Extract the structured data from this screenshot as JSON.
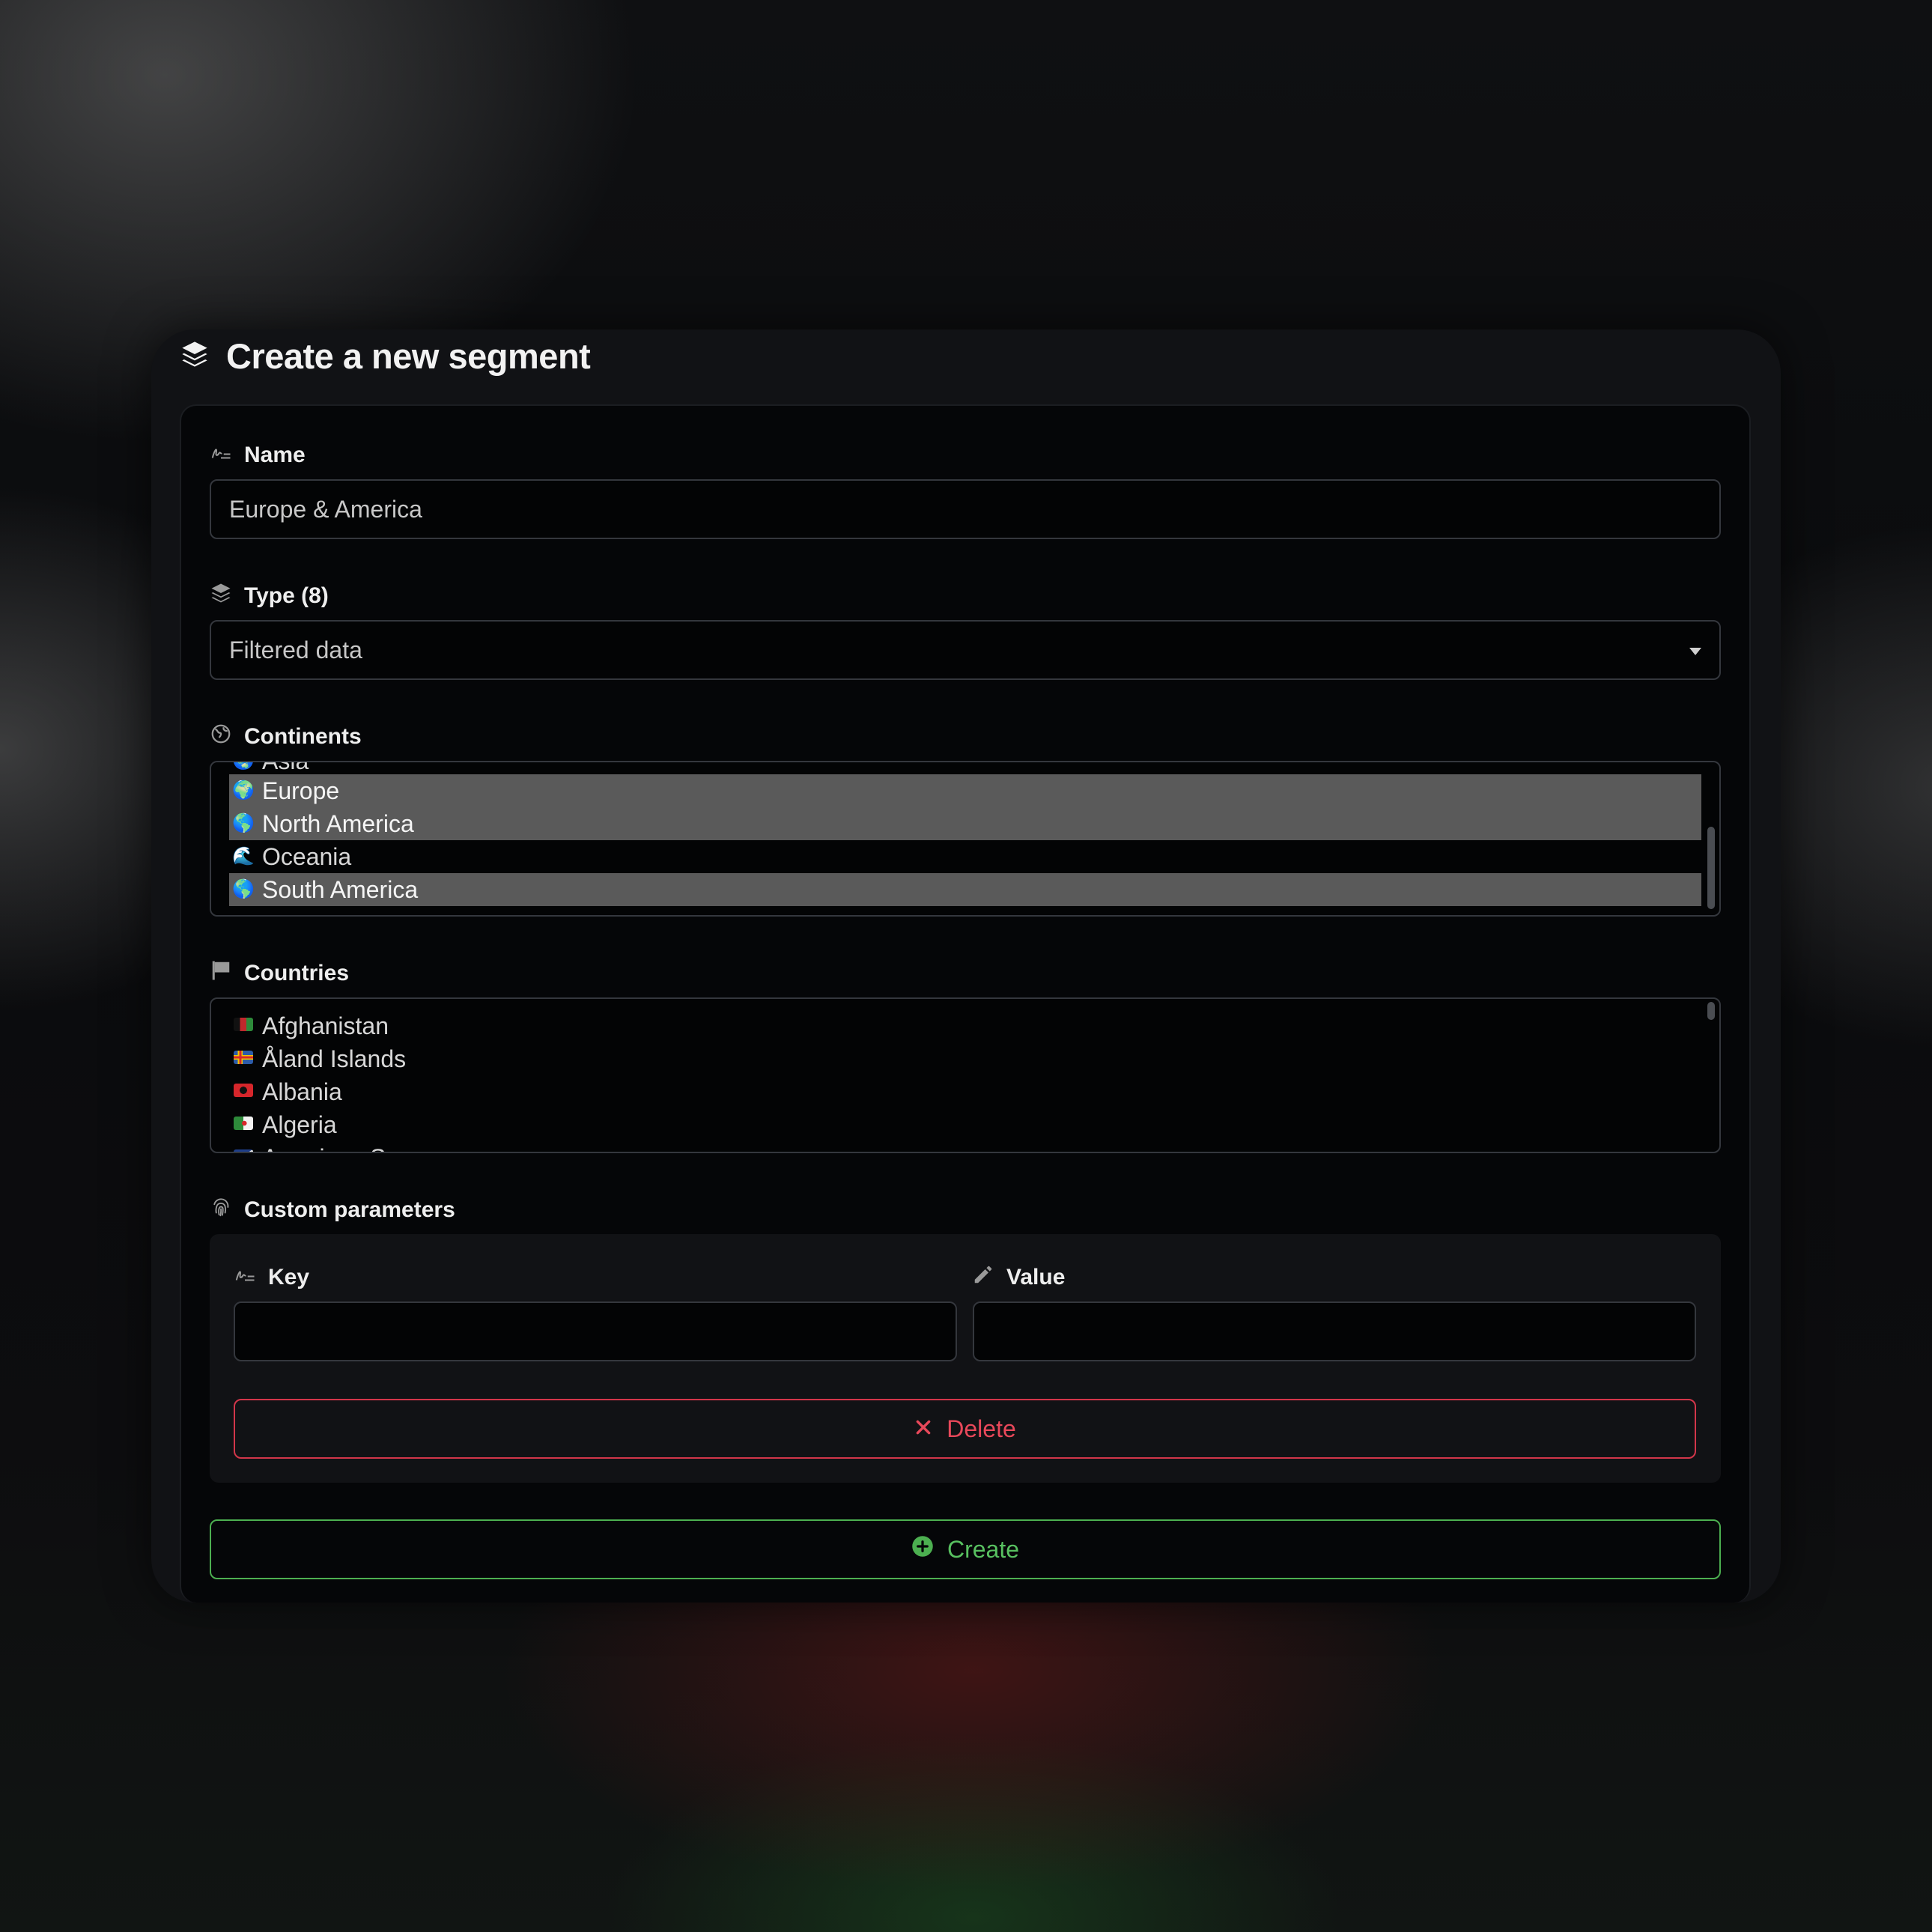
{
  "title": "Create a new segment",
  "name_field": {
    "label": "Name",
    "value": "Europe & America"
  },
  "type_field": {
    "label": "Type (8)",
    "value": "Filtered data"
  },
  "continents": {
    "label": "Continents",
    "partial_top": "Asia",
    "items": [
      {
        "label": "Europe",
        "icon": "🌍",
        "selected": true
      },
      {
        "label": "North America",
        "icon": "🌎",
        "selected": true
      },
      {
        "label": "Oceania",
        "icon": "🌊",
        "selected": false
      },
      {
        "label": "South America",
        "icon": "🌎",
        "selected": true
      }
    ]
  },
  "countries": {
    "label": "Countries",
    "items": [
      {
        "label": "Afghanistan",
        "flag": "flag-afghanistan"
      },
      {
        "label": "Åland Islands",
        "flag": "flag-aland"
      },
      {
        "label": "Albania",
        "flag": "flag-albania"
      },
      {
        "label": "Algeria",
        "flag": "flag-algeria"
      }
    ],
    "partial_bottom": "American Samoa"
  },
  "custom_parameters": {
    "label": "Custom parameters",
    "key_label": "Key",
    "value_label": "Value",
    "key_value": "",
    "value_value": "",
    "delete_label": "Delete"
  },
  "create_label": "Create",
  "colors": {
    "delete": "#e8485a",
    "create": "#58c060",
    "selected_option": "#5a5a5a"
  }
}
